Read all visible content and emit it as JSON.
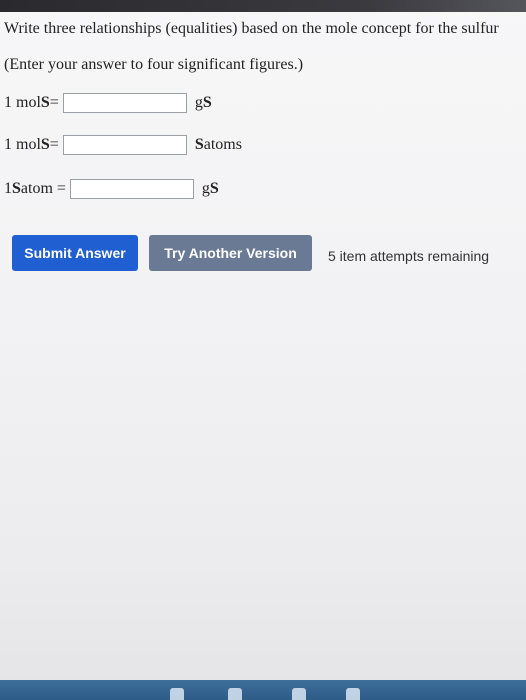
{
  "question": {
    "line1": "Write three relationships (equalities) based on the mole concept for the sulfur",
    "line2": "(Enter your answer to four significant figures.)"
  },
  "rows": [
    {
      "left_prefix": "1 mol ",
      "left_symbol": "S",
      "equals": " =",
      "unit_prefix": "g ",
      "unit_symbol": "S",
      "unit_suffix": "",
      "value": ""
    },
    {
      "left_prefix": "1 mol ",
      "left_symbol": "S",
      "equals": " =",
      "unit_prefix": "",
      "unit_symbol": "S",
      "unit_suffix": " atoms",
      "value": ""
    },
    {
      "left_prefix": "1 ",
      "left_symbol": "S",
      "equals": " atom =",
      "unit_prefix": "g ",
      "unit_symbol": "S",
      "unit_suffix": "",
      "value": ""
    }
  ],
  "buttons": {
    "submit": "Submit Answer",
    "try_another": "Try Another Version"
  },
  "attempts_text": "5 item attempts remaining",
  "colors": {
    "submit_bg": "#1f5fd1",
    "try_bg": "#6a7a95"
  }
}
